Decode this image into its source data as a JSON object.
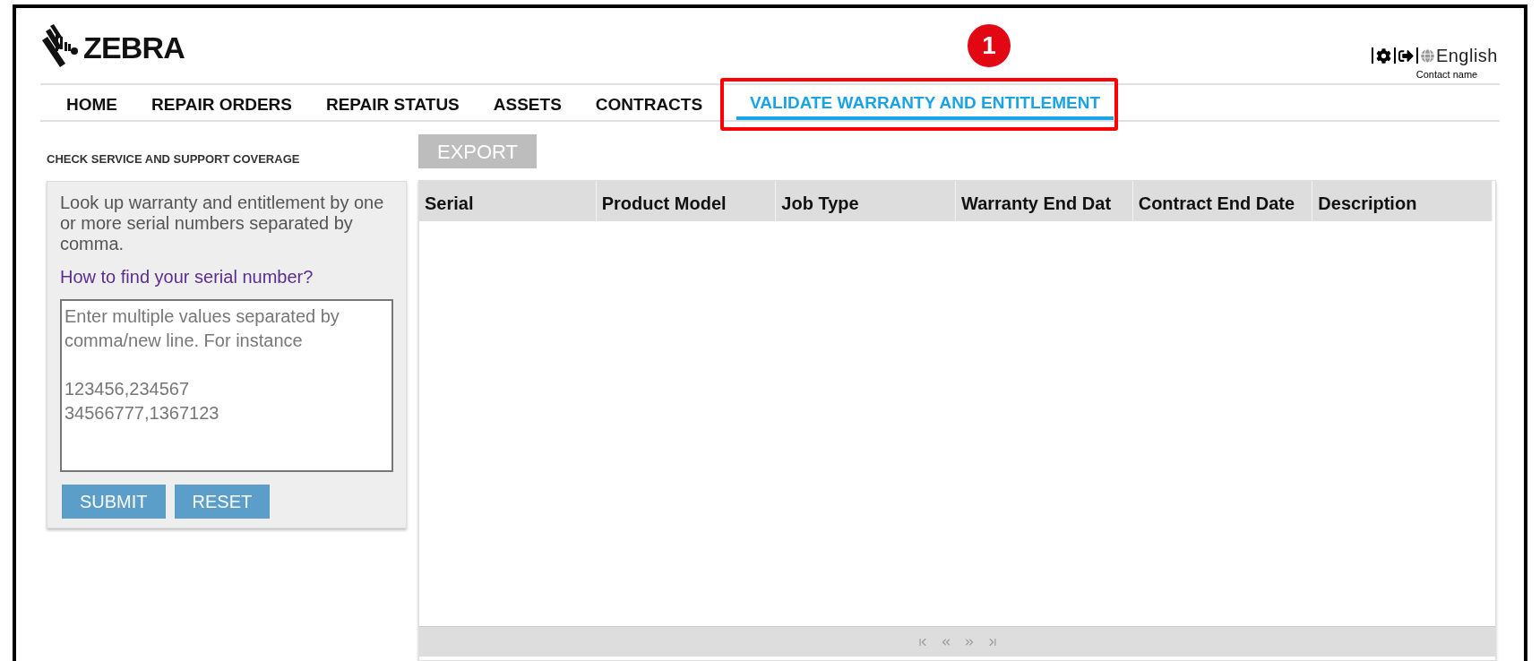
{
  "header": {
    "logo_text": "ZEBRA",
    "language": "English",
    "user": "Contact name"
  },
  "annotation": {
    "marker": "1"
  },
  "nav": [
    {
      "label": "HOME",
      "selected": false
    },
    {
      "label": "REPAIR ORDERS",
      "selected": false
    },
    {
      "label": "REPAIR STATUS",
      "selected": false
    },
    {
      "label": "ASSETS",
      "selected": false
    },
    {
      "label": "CONTRACTS",
      "selected": false
    },
    {
      "label": "VALIDATE WARRANTY AND ENTITLEMENT",
      "selected": true
    }
  ],
  "sidebar": {
    "heading": "CHECK SERVICE AND SUPPORT COVERAGE",
    "description": "Look up warranty and entitlement by one or more serial numbers separated by comma.",
    "link": "How to find your serial number?",
    "serials_field": {
      "placeholder": "Enter multiple values separated by comma/new line. For instance\n\n123456,234567\n34566777,1367123"
    },
    "buttons": [
      "SUBMIT",
      "RESET"
    ]
  },
  "export_button": {
    "label": "EXPORT",
    "disabled": true
  },
  "table": {
    "columns": [
      "Serial",
      "Product Model",
      "Job Type",
      "Warranty End Dat",
      "Contract End Date",
      "Description"
    ]
  }
}
